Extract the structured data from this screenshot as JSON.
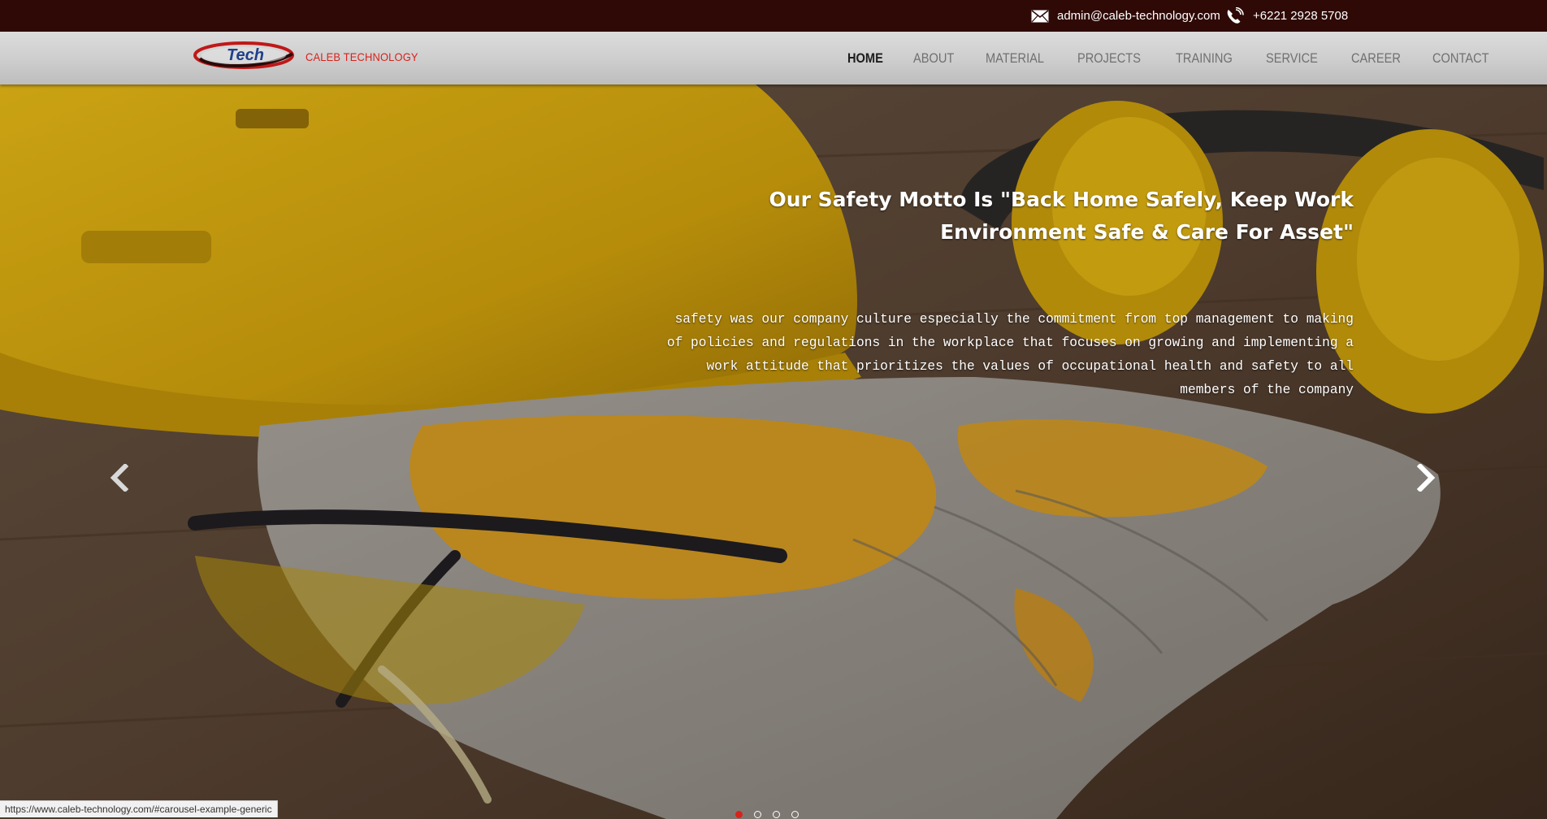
{
  "topbar": {
    "email": "admin@caleb-technology.com",
    "phone": "+6221 2928 5708",
    "email_icon": "envelope-icon",
    "phone_icon": "phone-icon"
  },
  "brand": {
    "logo_text": "Tech",
    "name": "CALEB TECHNOLOGY"
  },
  "nav": {
    "items": [
      {
        "label": "HOME",
        "active": true
      },
      {
        "label": "ABOUT"
      },
      {
        "label": "MATERIAL"
      },
      {
        "label": "PROJECTS"
      },
      {
        "label": "TRAINING"
      },
      {
        "label": "SERVICE"
      },
      {
        "label": "CAREER"
      },
      {
        "label": "CONTACT"
      }
    ]
  },
  "hero": {
    "title": "Our Safety Motto Is \"Back Home Safely, Keep Work Environment Safe & Care For Asset\"",
    "text": "safety was our company culture especially the commitment from top management to making of policies and regulations in the workplace that focuses on growing and implementing a work attitude that prioritizes the values of occupational health and safety to all members of the company",
    "prev_icon": "chevron-left-icon",
    "next_icon": "chevron-right-icon",
    "slide_count": 4,
    "active_slide": 1
  },
  "statusbar": {
    "url": "https://www.caleb-technology.com/#carousel-example-generic"
  },
  "colors": {
    "topbar_bg": "#2e0906",
    "accent_red": "#d8221c",
    "nav_active": "#1d1d1d",
    "nav_inactive": "#707070"
  }
}
